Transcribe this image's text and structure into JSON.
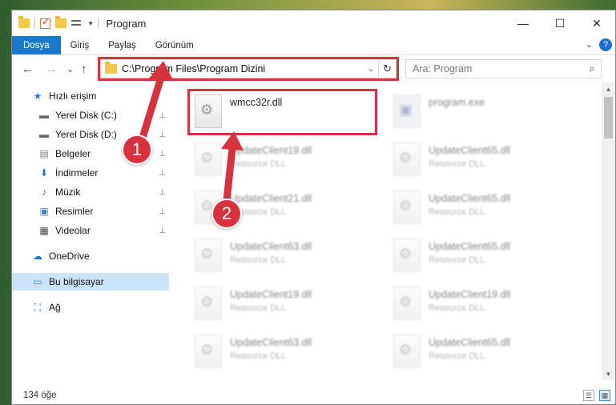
{
  "window": {
    "title": "Program",
    "minimize_glyph": "—",
    "maximize_glyph": "☐",
    "close_glyph": "✕"
  },
  "quick_access_toolbar": {
    "dropdown_glyph": "▾"
  },
  "ribbon": {
    "tabs": [
      {
        "label": "Dosya",
        "active": true
      },
      {
        "label": "Giriş",
        "active": false
      },
      {
        "label": "Paylaş",
        "active": false
      },
      {
        "label": "Görünüm",
        "active": false
      }
    ],
    "expand_glyph": "⌄",
    "help_glyph": "?"
  },
  "navigation": {
    "back_glyph": "←",
    "forward_glyph": "→",
    "recent_glyph": "⌄",
    "up_glyph": "↑",
    "address": "C:\\Program Files\\Program Dizini",
    "address_dropdown_glyph": "⌄",
    "refresh_glyph": "↻",
    "search_placeholder": "Ara: Program",
    "search_glyph": "⌕"
  },
  "sidebar": {
    "items": [
      {
        "label": "Hızlı erişim",
        "icon": "star-icon",
        "glyph": "★",
        "color": "#2b7de0",
        "pinned": false,
        "selected": false,
        "indent": 0
      },
      {
        "label": "Yerel Disk (C:)",
        "icon": "drive-icon",
        "glyph": "▬",
        "color": "#666666",
        "pinned": true,
        "selected": false,
        "indent": 1
      },
      {
        "label": "Yerel Disk (D:)",
        "icon": "drive-icon",
        "glyph": "▬",
        "color": "#666666",
        "pinned": true,
        "selected": false,
        "indent": 1
      },
      {
        "label": "Belgeler",
        "icon": "documents-icon",
        "glyph": "▤",
        "color": "#777777",
        "pinned": true,
        "selected": false,
        "indent": 1
      },
      {
        "label": "İndirmeler",
        "icon": "download-icon",
        "glyph": "⬇",
        "color": "#1f73d6",
        "pinned": true,
        "selected": false,
        "indent": 1
      },
      {
        "label": "Müzik",
        "icon": "music-icon",
        "glyph": "♪",
        "color": "#1f73d6",
        "pinned": true,
        "selected": false,
        "indent": 1
      },
      {
        "label": "Resimler",
        "icon": "pictures-icon",
        "glyph": "▣",
        "color": "#4a7fb5",
        "pinned": true,
        "selected": false,
        "indent": 1
      },
      {
        "label": "Videolar",
        "icon": "video-icon",
        "glyph": "▦",
        "color": "#444444",
        "pinned": true,
        "selected": false,
        "indent": 1
      },
      {
        "label": "OneDrive",
        "icon": "cloud-icon",
        "glyph": "☁",
        "color": "#1f73d6",
        "pinned": false,
        "selected": false,
        "indent": 0
      },
      {
        "label": "Bu bilgisayar",
        "icon": "computer-icon",
        "glyph": "▭",
        "color": "#2e89d6",
        "pinned": false,
        "selected": true,
        "indent": 0
      },
      {
        "label": "Ağ",
        "icon": "network-icon",
        "glyph": "⛶",
        "color": "#2e89d6",
        "pinned": false,
        "selected": false,
        "indent": 0
      }
    ],
    "pin_glyph": "📌"
  },
  "files": [
    {
      "name": "wmcc32r.dll",
      "type": "",
      "blurred": false,
      "kind": "dll"
    },
    {
      "name": "program.exe",
      "type": "",
      "blurred": true,
      "kind": "exe"
    },
    {
      "name": "UpdateClient19.dll",
      "type": "Resource DLL",
      "blurred": true,
      "kind": "dll"
    },
    {
      "name": "UpdateClient65.dll",
      "type": "Resource DLL",
      "blurred": true,
      "kind": "dll"
    },
    {
      "name": "UpdateClient21.dll",
      "type": "Resource DLL",
      "blurred": true,
      "kind": "dll"
    },
    {
      "name": "UpdateClient65.dll",
      "type": "Resource DLL",
      "blurred": true,
      "kind": "dll"
    },
    {
      "name": "UpdateClient63.dll",
      "type": "Resource DLL",
      "blurred": true,
      "kind": "dll"
    },
    {
      "name": "UpdateClient65.dll",
      "type": "Resource DLL",
      "blurred": true,
      "kind": "dll"
    },
    {
      "name": "UpdateClient19.dll",
      "type": "Resource DLL",
      "blurred": true,
      "kind": "dll"
    },
    {
      "name": "UpdateClient19.dll",
      "type": "Resource DLL",
      "blurred": true,
      "kind": "dll"
    },
    {
      "name": "UpdateClient63.dll",
      "type": "Resource DLL",
      "blurred": true,
      "kind": "dll"
    },
    {
      "name": "UpdateClient65.dll",
      "type": "Resource DLL",
      "blurred": true,
      "kind": "dll"
    }
  ],
  "status": {
    "item_count": "134 öğe"
  },
  "annotations": {
    "step1": "1",
    "step2": "2",
    "highlight_color": "#d6333e"
  }
}
